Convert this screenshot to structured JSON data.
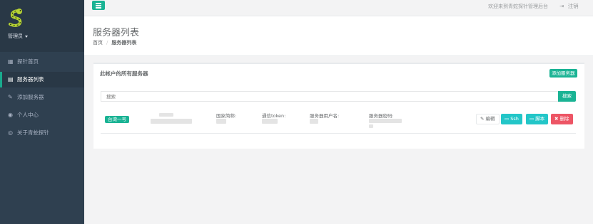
{
  "sidebar": {
    "role": "管理员",
    "items": [
      {
        "label": "探针首页",
        "icon": "grid-icon"
      },
      {
        "label": "服务器列表",
        "icon": "table-icon",
        "active": true
      },
      {
        "label": "添加服务器",
        "icon": "edit-icon"
      },
      {
        "label": "个人中心",
        "icon": "user-circle-icon"
      },
      {
        "label": "关于青蛇探针",
        "icon": "eye-icon"
      }
    ]
  },
  "topbar": {
    "welcome": "欢迎来到青蛇探针管理后台",
    "logout": "注销"
  },
  "heading": {
    "title": "服务器列表",
    "breadcrumb": [
      "首页",
      "服务器列表"
    ]
  },
  "panel": {
    "title": "此帐户的所有服务器",
    "add_button": "添加服务器",
    "search_placeholder": "搜索",
    "search_button": "搜索"
  },
  "servers": [
    {
      "name": "台湾一号",
      "fields": {
        "country_label": "国家简称:",
        "token_label": "通信token:",
        "user_label": "服务器用户名:",
        "password_label": "服务器密码:"
      },
      "actions": {
        "edit": "编辑",
        "ssh": "Ssh",
        "script": "脚本",
        "delete": "删除"
      }
    }
  ],
  "colors": {
    "sidebar": "#2f4050",
    "accent": "#1ab394",
    "info": "#23c6c8",
    "danger": "#ed5565"
  }
}
